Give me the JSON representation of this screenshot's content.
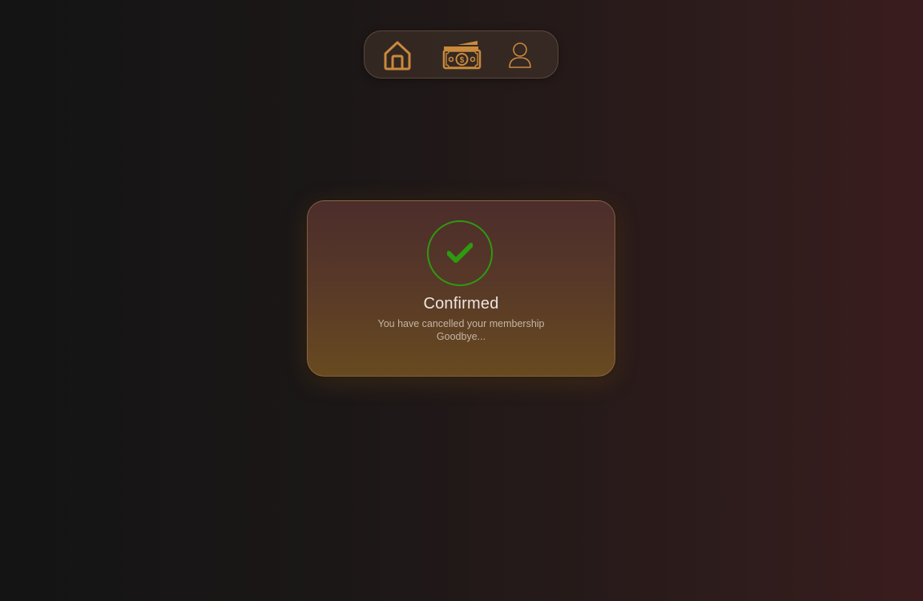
{
  "nav": {
    "items": [
      {
        "id": "home",
        "icon": "home-icon",
        "label": ""
      },
      {
        "id": "money",
        "icon": "cash-icon",
        "label": ""
      },
      {
        "id": "profile",
        "icon": "user-icon",
        "label": ""
      }
    ],
    "icon_color": "#c98a3c"
  },
  "dialog": {
    "title": "Confirmed",
    "message_line1": "You have cancelled your membership",
    "message_line2": "Goodbye...",
    "status_icon": "check-icon",
    "status_color": "#2e9a10"
  }
}
